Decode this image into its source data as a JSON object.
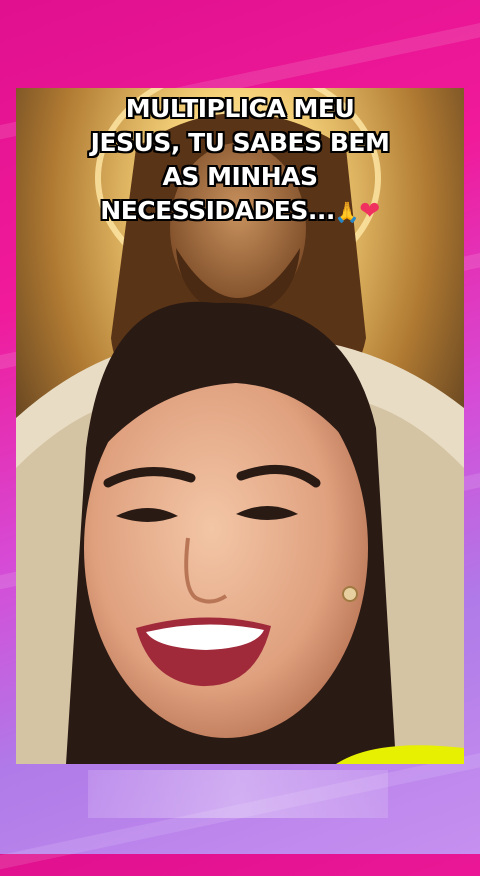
{
  "caption": {
    "lines": [
      "MULTIPLICA MEU",
      "JESUS, TU SABES BEM",
      "AS MINHAS",
      "NECESSIDADES..."
    ],
    "emoji_hands": "🙏",
    "emoji_heart": "❤"
  },
  "image": {
    "subject": "smiling woman in front of glowing Jesus portrait"
  },
  "colors": {
    "background_top": "#e0108e",
    "background_bottom": "#c690f0",
    "glow": "#f6d27a"
  }
}
